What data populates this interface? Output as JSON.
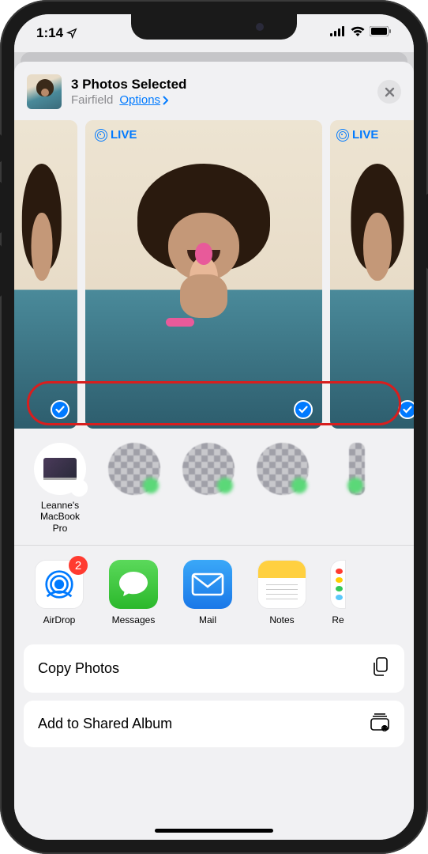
{
  "statusBar": {
    "time": "1:14"
  },
  "header": {
    "title": "3 Photos Selected",
    "location": "Fairfield",
    "optionsLabel": "Options"
  },
  "photos": {
    "liveBadge": "LIVE"
  },
  "airdropTargets": [
    {
      "label": "Leanne's\nMacBook Pro",
      "type": "device"
    }
  ],
  "apps": [
    {
      "label": "AirDrop",
      "badge": "2"
    },
    {
      "label": "Messages"
    },
    {
      "label": "Mail"
    },
    {
      "label": "Notes"
    },
    {
      "label": "Re"
    }
  ],
  "actions": {
    "copy": "Copy Photos",
    "addToShared": "Add to Shared Album"
  },
  "colors": {
    "accent": "#007aff",
    "badge": "#ff3b30",
    "highlight": "#d81e1e"
  }
}
